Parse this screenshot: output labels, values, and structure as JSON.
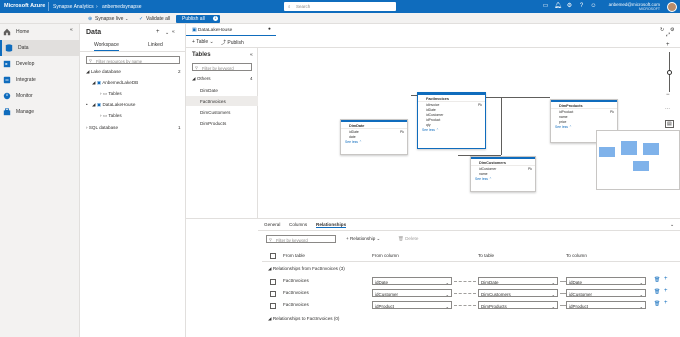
{
  "topbar": {
    "brand": "Microsoft Azure",
    "crumb1": "Synapse Analytics",
    "crumb2": "anbemedsynapse",
    "search_placeholder": "Search",
    "user_email": "anbemed@microsoft.com",
    "user_tenant": "MICROSOFT"
  },
  "cmdbar": {
    "live_mode": "Synapse live",
    "validate": "Validate all",
    "publish": "Publish all",
    "publish_count": "1"
  },
  "nav": [
    {
      "label": "Home",
      "icon": "home-icon"
    },
    {
      "label": "Data",
      "icon": "database-icon"
    },
    {
      "label": "Develop",
      "icon": "develop-icon"
    },
    {
      "label": "Integrate",
      "icon": "pipeline-icon"
    },
    {
      "label": "Monitor",
      "icon": "monitor-icon"
    },
    {
      "label": "Manage",
      "icon": "toolbox-icon"
    }
  ],
  "datapane": {
    "title": "Data",
    "tabs": [
      "Workspace",
      "Linked"
    ],
    "filter_placeholder": "Filter resources by name",
    "lake_db": "Lake database",
    "lake_db_count": "2",
    "db1": "AnbemedLakeDB",
    "db1_tables": "Tables",
    "db2": "DataLakeHouse",
    "db2_tables": "Tables",
    "sql_db": "SQL database",
    "sql_db_count": "1"
  },
  "editor": {
    "doc_tab": "DataLakeHouse",
    "table_btn": "Table",
    "publish_btn": "Publish"
  },
  "tables_pane": {
    "title": "Tables",
    "filter_placeholder": "Filter by keyword",
    "others_label": "Others",
    "others_count": "4",
    "items": [
      "DimDate",
      "FactInvoices",
      "DimCustomers",
      "DimProducts"
    ]
  },
  "entities": {
    "factinvoices": {
      "name": "FactInvoices",
      "rows": [
        "idInvoice",
        "idDate",
        "idCustomer",
        "idProduct",
        "qty"
      ],
      "key": "Pk",
      "see_more": "See less"
    },
    "dimdate": {
      "name": "DimDate",
      "rows": [
        "idDate",
        "date"
      ],
      "key": "Pk",
      "see_more": "See less"
    },
    "dimproducts": {
      "name": "DimProducts",
      "rows": [
        "idProduct",
        "name",
        "price"
      ],
      "key": "Pk",
      "see_more": "See less"
    },
    "dimcustomers": {
      "name": "DimCustomers",
      "rows": [
        "idCustomer",
        "name"
      ],
      "key": "Pk",
      "see_more": "See less"
    }
  },
  "bottom": {
    "tabs": [
      "General",
      "Columns",
      "Relationships"
    ],
    "filter_placeholder": "Filter by keyword",
    "add_relationship": "Relationship",
    "delete": "Delete",
    "headers": [
      "From table",
      "From column",
      "To table",
      "To column"
    ],
    "section_from": "Relationships from FactInvoices (3)",
    "section_to": "Relationships to FactInvoices (0)",
    "rows": [
      {
        "from_table": "FactInvoices",
        "from_col": "idDate",
        "to_table": "DimDate",
        "to_col": "idDate"
      },
      {
        "from_table": "FactInvoices",
        "from_col": "idCustomer",
        "to_table": "DimCustomers",
        "to_col": "idCustomer"
      },
      {
        "from_table": "FactInvoices",
        "from_col": "idProduct",
        "to_table": "DimProducts",
        "to_col": "idProduct"
      }
    ]
  }
}
